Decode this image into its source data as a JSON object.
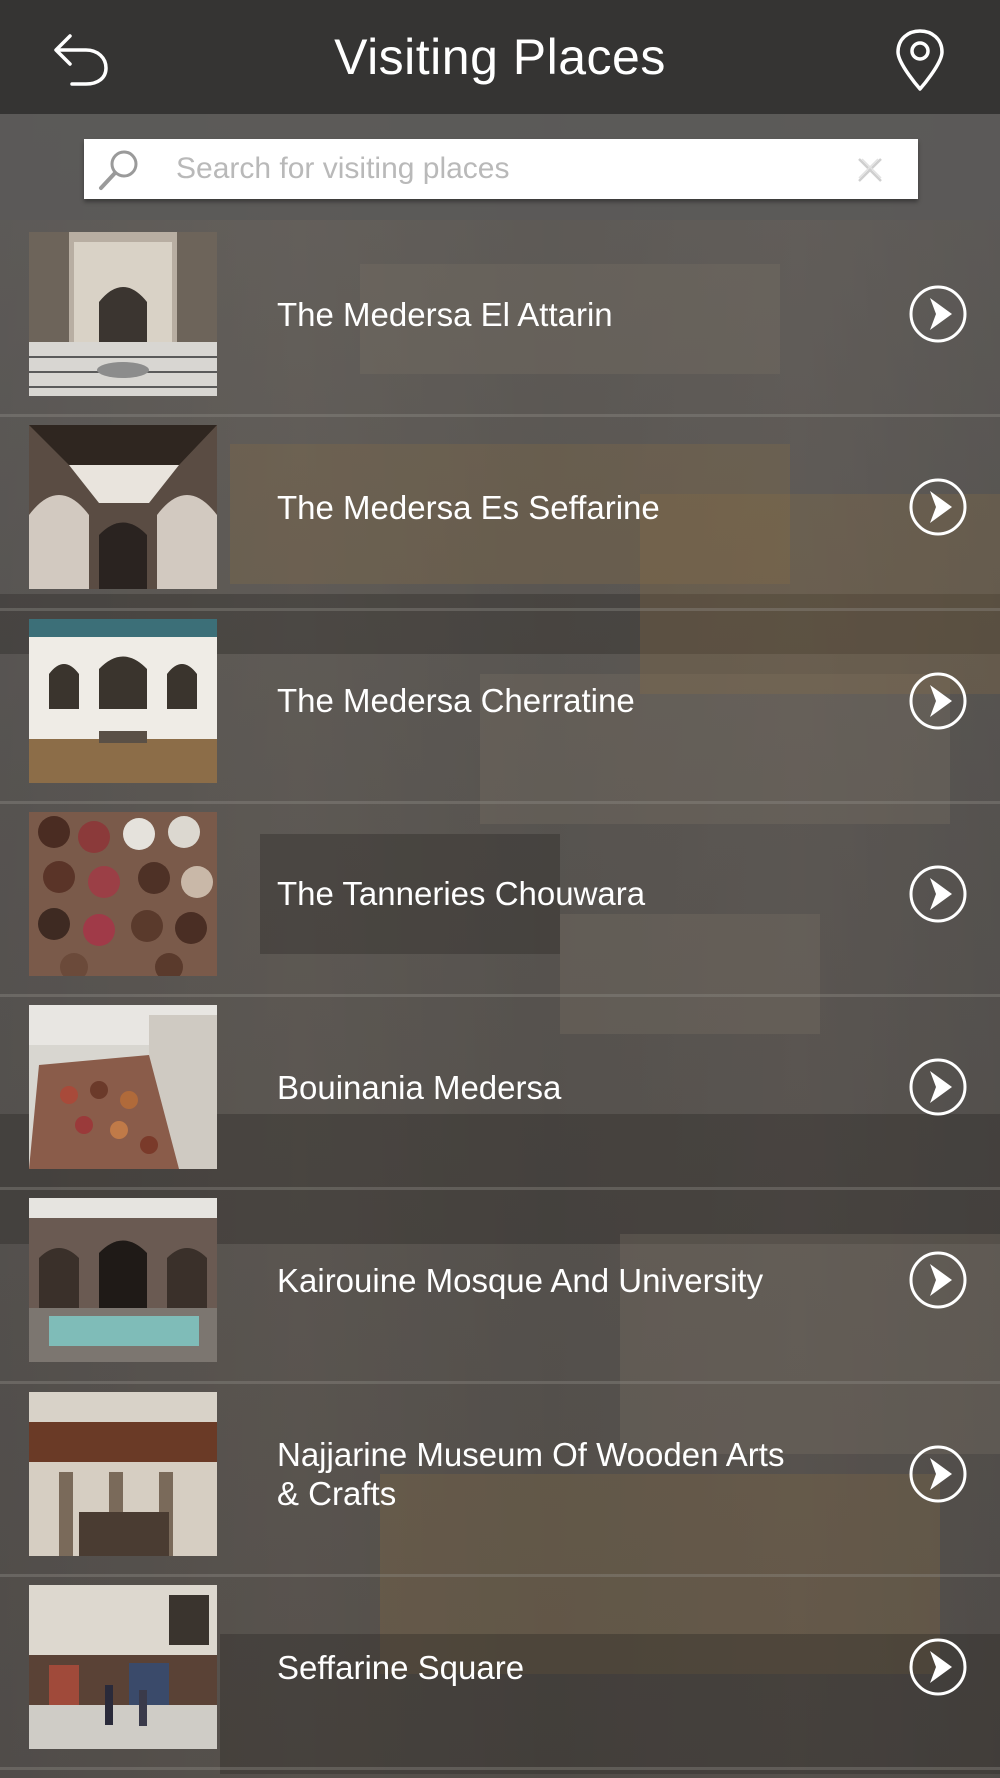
{
  "header": {
    "title": "Visiting Places",
    "back_icon": "back-arrow-icon",
    "location_icon": "map-pin-icon"
  },
  "search": {
    "placeholder": "Search for visiting places",
    "value": ""
  },
  "colors": {
    "header_bg": "#353433",
    "text": "#ffffff",
    "placeholder": "#b9b9b9"
  },
  "places": [
    {
      "label": "The Medersa El Attarin",
      "thumb": "courtyard-fountain"
    },
    {
      "label": "The Medersa Es Seffarine",
      "thumb": "arched-court"
    },
    {
      "label": "The Medersa Cherratine",
      "thumb": "white-arcade"
    },
    {
      "label": "The Tanneries Chouwara",
      "thumb": "dye-vats"
    },
    {
      "label": "Bouinania Medersa",
      "thumb": "tannery-overview"
    },
    {
      "label": "Kairouine Mosque And University",
      "thumb": "pool-courtyard"
    },
    {
      "label": "Najjarine Museum Of Wooden Arts & Crafts",
      "thumb": "wooden-balconies"
    },
    {
      "label": "Seffarine Square",
      "thumb": "market-square"
    }
  ]
}
